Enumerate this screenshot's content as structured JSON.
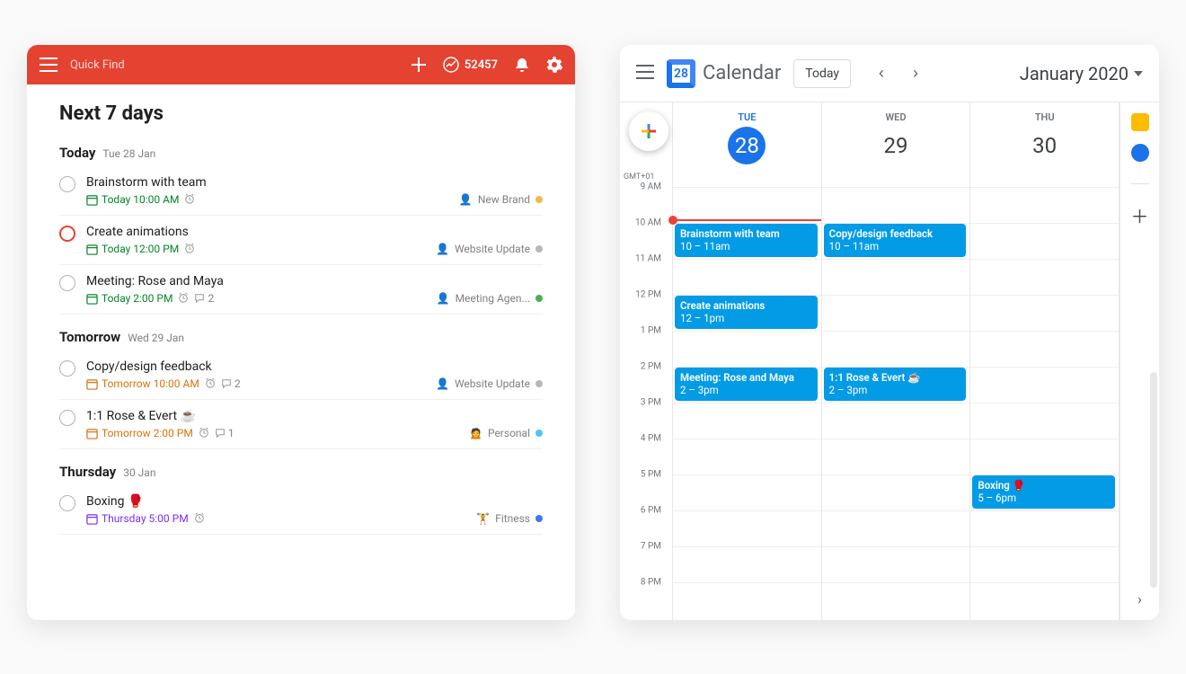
{
  "todoist": {
    "search_placeholder": "Quick Find",
    "karma": "52457",
    "title": "Next 7 days",
    "sections": [
      {
        "label": "Today",
        "date": "Tue 28 Jan",
        "tasks": [
          {
            "title": "Brainstorm with team",
            "dateText": "Today 10:00 AM",
            "dateColor": "#058527",
            "alarm": true,
            "comments": "",
            "project": "New Brand",
            "projIcon": "👤",
            "projColor": "#f2b84b",
            "priority": "normal"
          },
          {
            "title": "Create animations",
            "dateText": "Today 12:00 PM",
            "dateColor": "#058527",
            "alarm": true,
            "comments": "",
            "project": "Website Update",
            "projIcon": "👤",
            "projColor": "#b8b8b8",
            "priority": "high"
          },
          {
            "title": "Meeting: Rose and Maya",
            "dateText": "Today 2:00 PM",
            "dateColor": "#058527",
            "alarm": true,
            "comments": "2",
            "project": "Meeting Agen...",
            "projIcon": "👤",
            "projColor": "#4caf50",
            "priority": "normal"
          }
        ]
      },
      {
        "label": "Tomorrow",
        "date": "Wed 29 Jan",
        "tasks": [
          {
            "title": "Copy/design feedback",
            "dateText": "Tomorrow 10:00 AM",
            "dateColor": "#d9730d",
            "alarm": true,
            "comments": "2",
            "project": "Website Update",
            "projIcon": "👤",
            "projColor": "#b8b8b8",
            "priority": "normal"
          },
          {
            "title": "1:1 Rose & Evert ☕",
            "dateText": "Tomorrow 2:00 PM",
            "dateColor": "#d9730d",
            "alarm": true,
            "comments": "1",
            "project": "Personal",
            "projIcon": "🙍",
            "projColor": "#4fc3f7",
            "priority": "normal"
          }
        ]
      },
      {
        "label": "Thursday",
        "date": "30 Jan",
        "tasks": [
          {
            "title": "Boxing 🥊",
            "dateText": "Thursday 5:00 PM",
            "dateColor": "#7b2ff2",
            "alarm": true,
            "comments": "",
            "project": "Fitness",
            "projIcon": "🏋️",
            "projColor": "#4073ff",
            "priority": "normal"
          }
        ]
      }
    ]
  },
  "gcal": {
    "logo_day": "28",
    "logo_text": "Calendar",
    "today_btn": "Today",
    "month": "January 2020",
    "tz": "GMT+01",
    "hourStart": 9,
    "hourEnd": 20,
    "hourPx": 40,
    "nowHour": 9.9,
    "days": [
      {
        "dow": "TUE",
        "num": "28",
        "today": true
      },
      {
        "dow": "WED",
        "num": "29",
        "today": false
      },
      {
        "dow": "THU",
        "num": "30",
        "today": false
      }
    ],
    "events": [
      {
        "day": 0,
        "title": "Brainstorm with team",
        "time": "10 – 11am",
        "start": 10,
        "end": 11
      },
      {
        "day": 0,
        "title": "Create animations",
        "time": "12 – 1pm",
        "start": 12,
        "end": 13
      },
      {
        "day": 0,
        "title": "Meeting: Rose and Maya",
        "time": "2 – 3pm",
        "start": 14,
        "end": 15
      },
      {
        "day": 1,
        "title": "Copy/design feedback",
        "time": "10 – 11am",
        "start": 10,
        "end": 11
      },
      {
        "day": 1,
        "title": "1:1 Rose & Evert ☕",
        "time": "2 – 3pm",
        "start": 14,
        "end": 15
      },
      {
        "day": 2,
        "title": "Boxing 🥊",
        "time": "5 – 6pm",
        "start": 17,
        "end": 18
      }
    ]
  }
}
